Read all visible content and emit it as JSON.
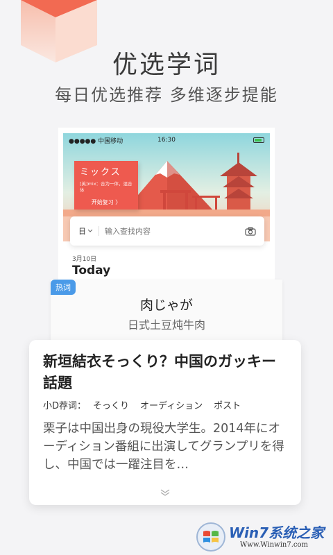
{
  "hero": {
    "title": "优选学词",
    "subtitle": "每日优选推荐  多维逐步提能"
  },
  "phone": {
    "status": {
      "carrier": "●●●●● 中国移动",
      "time": "16:30"
    },
    "word_card": {
      "word": "ミックス",
      "definition": "[英]mix：合为一体，混合体",
      "button": "开始复习 〉"
    },
    "search": {
      "lang": "日",
      "placeholder": "输入查找内容"
    },
    "date": "3月10日",
    "today": "Today"
  },
  "hot": {
    "tag": "热词",
    "word": "肉じゃが",
    "meaning": "日式土豆炖牛肉"
  },
  "article": {
    "title": "新垣結衣そっくり？中国のガッキー話題",
    "rec_label": "小D荐词：",
    "rec_words": [
      "そっくり",
      "オーディション",
      "ポスト"
    ],
    "body": "栗子は中国出身の現役大学生。2014年にオーディション番組に出演してグランプリを得し、中国では一躍注目を…"
  },
  "watermark": {
    "text": "Win7系统之家",
    "url": "Www.Winwin7.com"
  },
  "colors": {
    "accent_red": "#ee5a4f",
    "tag_blue": "#4a9ae8"
  }
}
